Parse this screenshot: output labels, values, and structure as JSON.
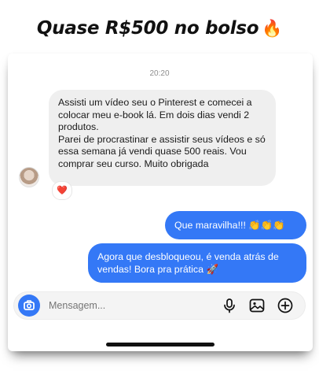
{
  "headline": {
    "text": "Quase R$500 no bolso",
    "emoji": "🔥"
  },
  "thread": {
    "timestamp": "20:20",
    "incoming": {
      "paragraphs": [
        "Assisti um vídeo seu o Pinterest e comecei a colocar meu e-book lá. Em dois dias vendi 2 produtos.",
        "Parei de procrastinar e assistir seus vídeos e só essa semana já vendi quase 500 reais. Vou comprar seu curso. Muito obrigada"
      ],
      "reaction": "❤️"
    },
    "outgoing": [
      {
        "text": "Que maravilha!!! 👏👏👏"
      },
      {
        "text": "Agora que desbloqueou, é venda atrás de vendas! Bora pra prática 🚀"
      }
    ]
  },
  "composer": {
    "placeholder": "Mensagem..."
  },
  "icons": {
    "camera": "camera-icon",
    "mic": "microphone-icon",
    "gallery": "image-icon",
    "add": "plus-circle-icon"
  },
  "colors": {
    "accent": "#3478f6",
    "incoming_bubble": "#efefef",
    "reaction": "#ed2f49"
  }
}
